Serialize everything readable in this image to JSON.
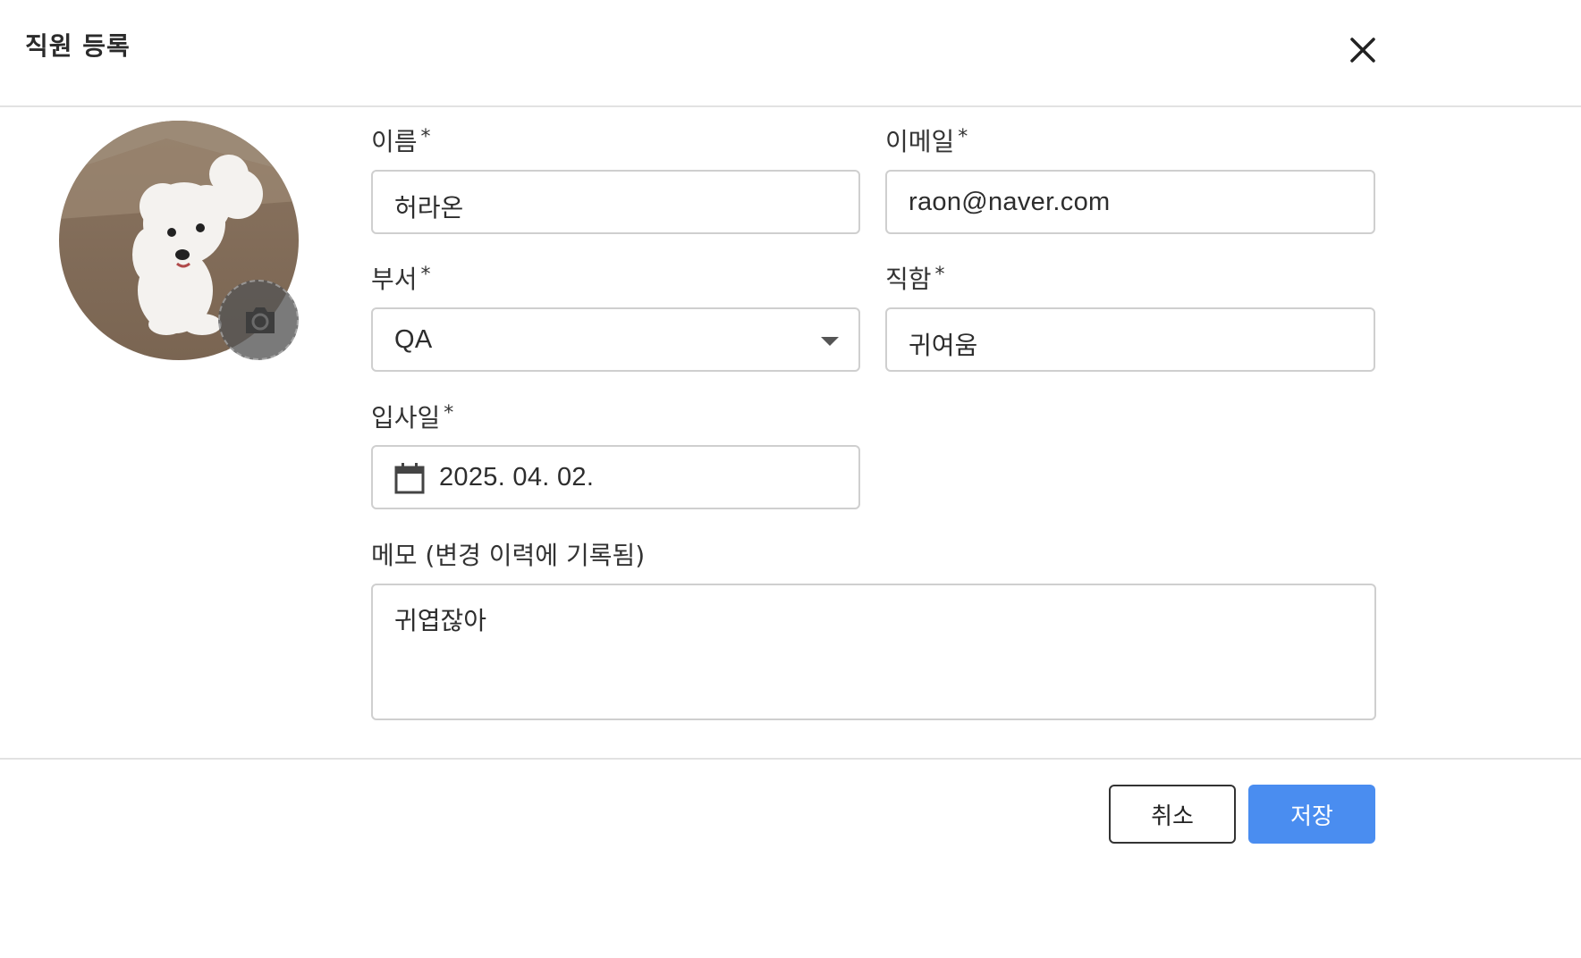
{
  "dialog": {
    "title": "직원 등록",
    "close_icon": "close-icon"
  },
  "profile": {
    "camera_icon": "camera-icon"
  },
  "form": {
    "name": {
      "label": "이름",
      "required_mark": "*",
      "value": "허라온"
    },
    "email": {
      "label": "이메일",
      "required_mark": "*",
      "value": "raon@naver.com"
    },
    "department": {
      "label": "부서",
      "required_mark": "*",
      "value": "QA"
    },
    "position": {
      "label": "직함",
      "required_mark": "*",
      "value": "귀여움"
    },
    "hire_date": {
      "label": "입사일",
      "required_mark": "*",
      "value": "2025. 04. 02.",
      "icon": "calendar-icon"
    },
    "memo": {
      "label": "메모 (변경 이력에 기록됨)",
      "value": "귀엽잖아"
    }
  },
  "footer": {
    "cancel_label": "취소",
    "save_label": "저장"
  },
  "colors": {
    "primary": "#4a8df0",
    "border": "#cfcfcf",
    "text": "#222222"
  }
}
